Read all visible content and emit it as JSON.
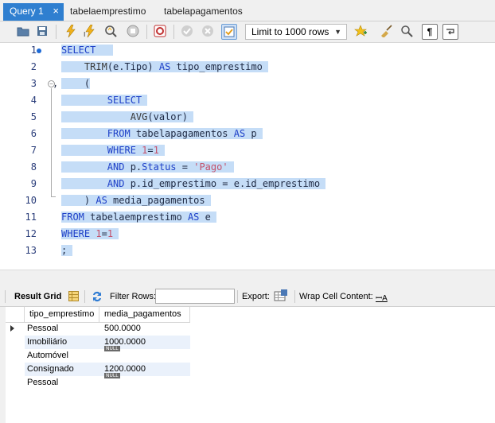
{
  "tabs": [
    {
      "label": "Query 1",
      "close": "×"
    },
    {
      "label": "tabelaemprestimo"
    },
    {
      "label": "tabelapagamentos"
    }
  ],
  "toolbar": {
    "limit_label": "Limit to 1000 rows"
  },
  "editor": {
    "line_numbers": [
      "1",
      "2",
      "3",
      "4",
      "5",
      "6",
      "7",
      "8",
      "9",
      "10",
      "11",
      "12",
      "13"
    ],
    "fold_marker": "−"
  },
  "results": {
    "grid_label": "Result Grid",
    "filter_label": "Filter Rows:",
    "export_label": "Export:",
    "wrap_label": "Wrap Cell Content:",
    "wrap_icon_text": "ꟷA",
    "columns": [
      "tipo_emprestimo",
      "media_pagamentos"
    ],
    "rows": [
      {
        "tipo": "Pessoal",
        "media": "500.0000"
      },
      {
        "tipo": "Imobiliário",
        "media": "1000.0000"
      },
      {
        "tipo": "Automóvel",
        "media": "NULL"
      },
      {
        "tipo": "Consignado",
        "media": "1200.0000"
      },
      {
        "tipo": "Pessoal",
        "media": "NULL"
      }
    ]
  }
}
